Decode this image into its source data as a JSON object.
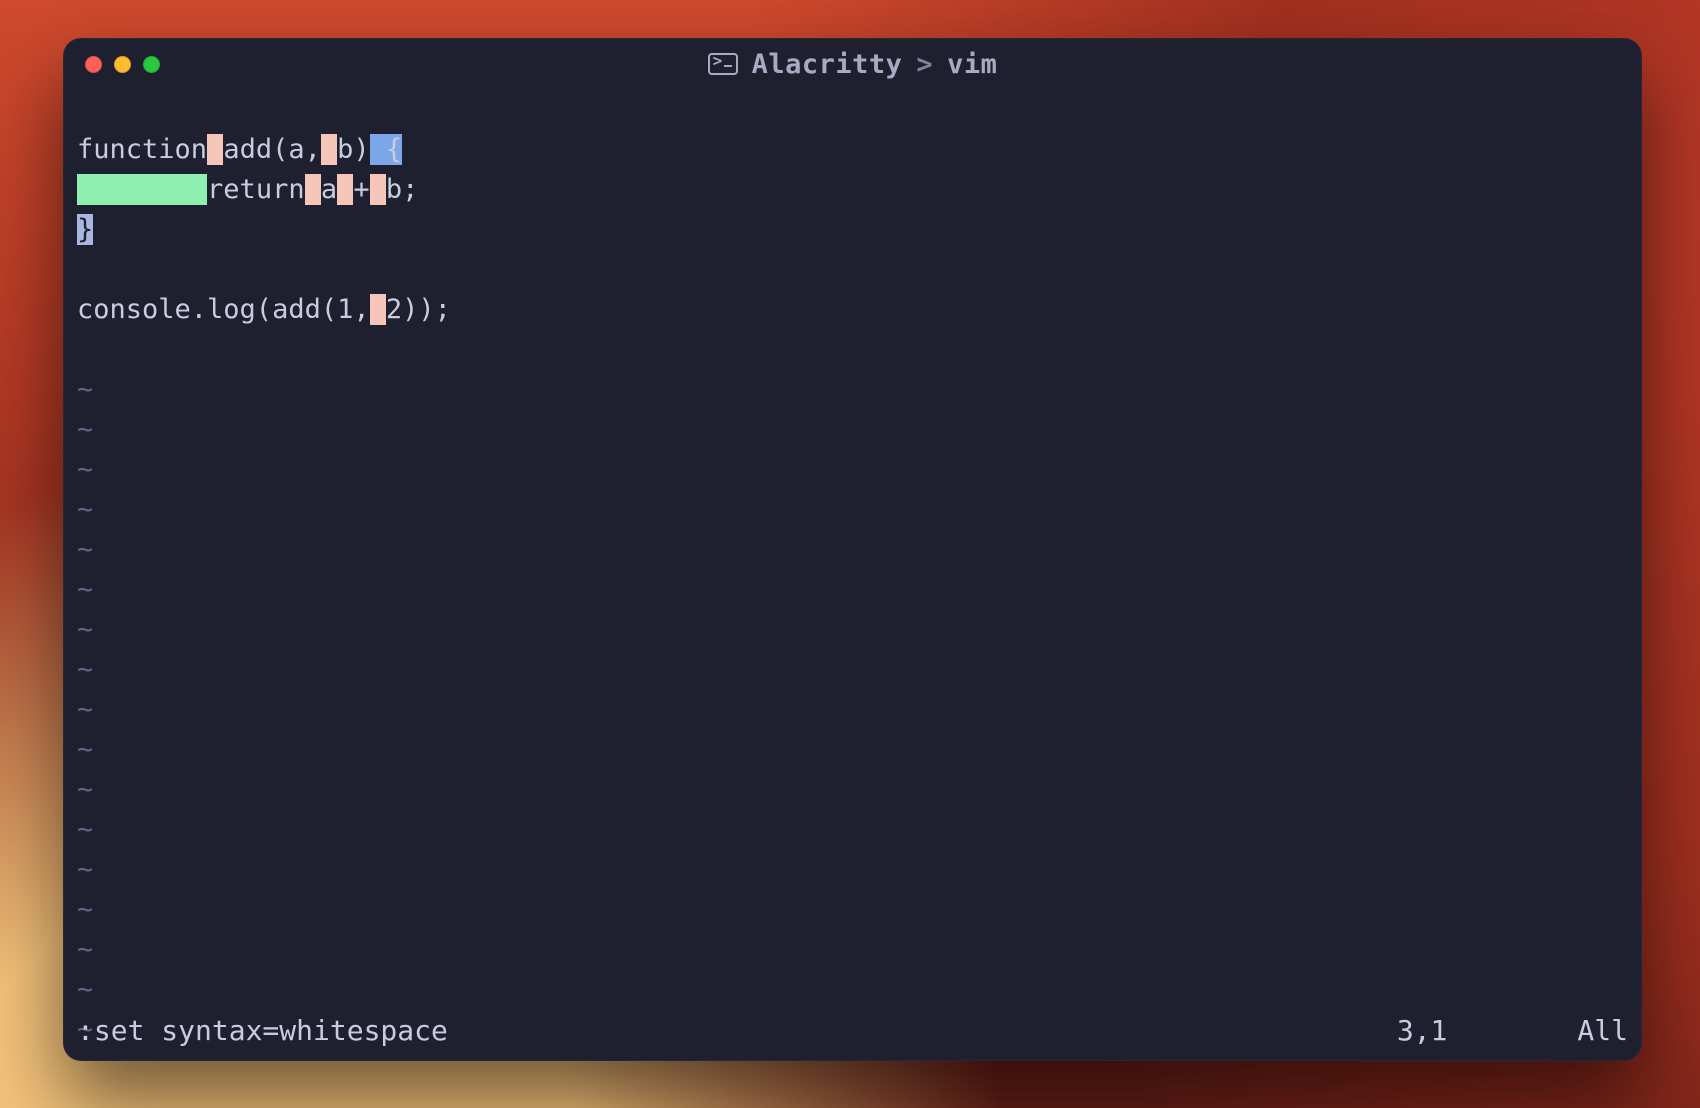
{
  "title": {
    "app": "Alacritty",
    "separator": ">",
    "sub": "vim"
  },
  "code": {
    "line1": {
      "kw": "function",
      "fn": "add(a,",
      "arg2": "b)",
      "tail": " {"
    },
    "line2": {
      "kw": "return",
      "expr1": "a",
      "op": "+",
      "expr2": "b;",
      "indent": "        "
    },
    "line3": {
      "brace": "}"
    },
    "line4": "",
    "line5": {
      "pre": "console.log(add(1,",
      "arg": "2));",
      "sp": " "
    }
  },
  "tilde": "~",
  "tilde_count": 17,
  "status": {
    "left": ":set syntax=whitespace",
    "pos": "3,1",
    "pct": "All"
  }
}
